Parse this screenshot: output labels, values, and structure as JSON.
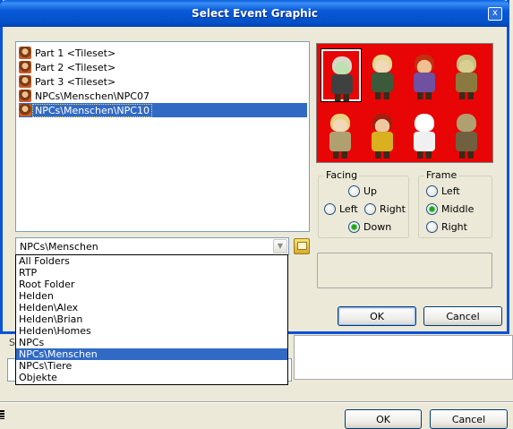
{
  "dialog": {
    "title": "Select Event Graphic",
    "close_glyph": "x"
  },
  "file_list": {
    "items": [
      {
        "label": "Part 1 <Tileset>",
        "selected": false
      },
      {
        "label": "Part 2 <Tileset>",
        "selected": false
      },
      {
        "label": "Part 3 <Tileset>",
        "selected": false
      },
      {
        "label": "NPCs\\Menschen\\NPC07",
        "selected": false
      },
      {
        "label": "NPCs\\Menschen\\NPC10",
        "selected": true
      }
    ]
  },
  "preview": {
    "background_color": "#e70505",
    "selected_index": 0,
    "sprites": [
      {
        "icon": "pale-old-man-sprite",
        "hair": "#d8d8c8",
        "skin": "#bfe0b0",
        "body": "#404040"
      },
      {
        "icon": "blonde-girl-sprite",
        "hair": "#e8d890",
        "skin": "#f0d8b8",
        "body": "#3a5a3a"
      },
      {
        "icon": "red-haired-warrior-sprite",
        "hair": "#c03010",
        "skin": "#f0c090",
        "body": "#7050a0"
      },
      {
        "icon": "goblin-sprite",
        "hair": "#c8c080",
        "skin": "#d8d090",
        "body": "#8a7a40"
      },
      {
        "icon": "blonde-boy-sprite",
        "hair": "#e8d080",
        "skin": "#f0d8b8",
        "body": "#b0a070"
      },
      {
        "icon": "red-haired-mage-sprite",
        "hair": "#a02010",
        "skin": "#f0c8a0",
        "body": "#d8b020"
      },
      {
        "icon": "ghost-sprite",
        "hair": "#ffffff",
        "skin": "#ffffff",
        "body": "#f0f0f0"
      },
      {
        "icon": "crossed-swords-sprite",
        "hair": "#b0a070",
        "skin": "#b0a070",
        "body": "#706040"
      }
    ]
  },
  "facing": {
    "label": "Facing",
    "options": [
      "Up",
      "Left",
      "Right",
      "Down"
    ],
    "selected": "Down"
  },
  "frame": {
    "label": "Frame",
    "options": [
      "Left",
      "Middle",
      "Right"
    ],
    "selected": "Middle"
  },
  "folder_combo": {
    "value": "NPCs\\Menschen",
    "options": [
      "All Folders",
      "RTP",
      "Root Folder",
      "Helden",
      "Helden\\Alex",
      "Helden\\Brian",
      "Helden\\Homes",
      "NPCs",
      "NPCs\\Menschen",
      "NPCs\\Tiere",
      "Objekte"
    ],
    "highlighted": "NPCs\\Menschen"
  },
  "buttons": {
    "ok": "OK",
    "cancel": "Cancel"
  },
  "background_window": {
    "label": "S",
    "ok": "OK",
    "cancel": "Cancel"
  },
  "colors": {
    "titlebar": "#0a5fe0",
    "selection": "#316ac5",
    "dialog_bg": "#ece9d8"
  }
}
